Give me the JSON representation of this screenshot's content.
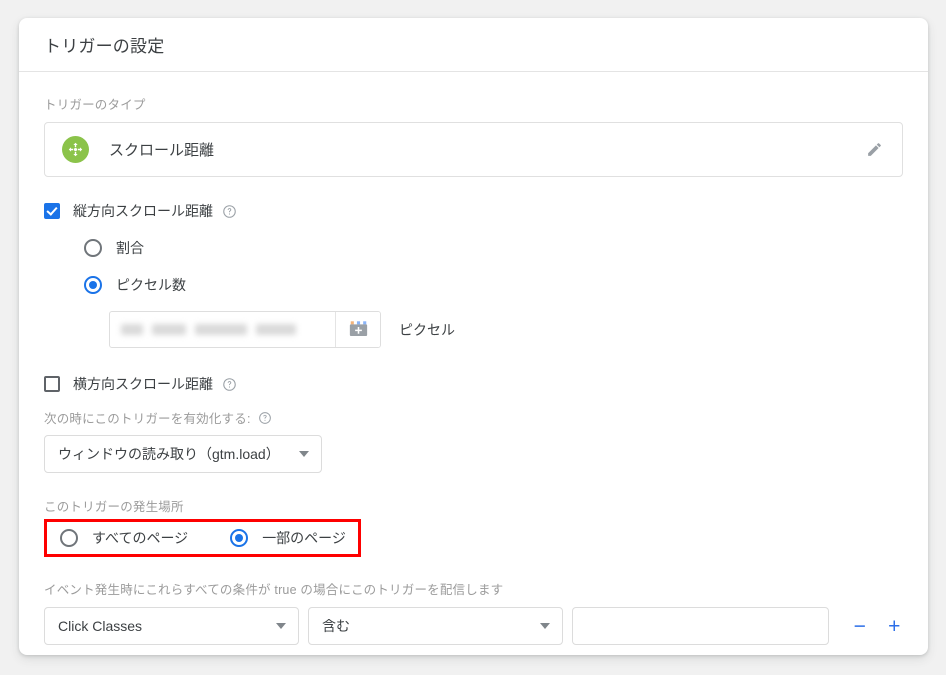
{
  "card": {
    "title": "トリガーの設定"
  },
  "trigger_type": {
    "label": "トリガーのタイプ",
    "name": "スクロール距離",
    "icon": "scroll-distance-icon",
    "icon_color": "#8bc34a",
    "edit_icon": "pencil-icon"
  },
  "vertical": {
    "checkbox_label": "縦方向スクロール距離",
    "checked": true,
    "help_icon": "help-circle-icon",
    "options": [
      {
        "label": "割合",
        "selected": false
      },
      {
        "label": "ピクセル数",
        "selected": true
      }
    ],
    "value_field": {
      "value": "",
      "placeholder": "",
      "redacted": true,
      "variable_button_icon": "insert-variable-icon"
    },
    "unit": "ピクセル"
  },
  "horizontal": {
    "checkbox_label": "横方向スクロール距離",
    "checked": false,
    "help_icon": "help-circle-icon"
  },
  "enable_when": {
    "label": "次の時にこのトリガーを有効化する:",
    "help_icon": "help-circle-icon",
    "selected": "ウィンドウの読み取り（gtm.load）"
  },
  "fire_on": {
    "label": "このトリガーの発生場所",
    "highlight_color": "#fe0000",
    "options": [
      {
        "label": "すべてのページ",
        "selected": false
      },
      {
        "label": "一部のページ",
        "selected": true
      }
    ]
  },
  "conditions": {
    "label": "イベント発生時にこれらすべての条件が true の場合にこのトリガーを配信します",
    "variable": "Click Classes",
    "operator": "含む",
    "value": "",
    "value_placeholder": "",
    "remove_label": "−",
    "add_label": "+",
    "accent_color": "#2d6fe8"
  }
}
